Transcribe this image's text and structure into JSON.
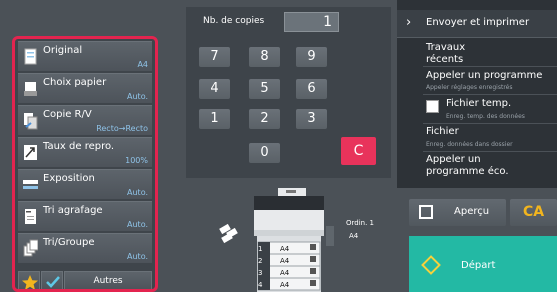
{
  "left_panel": {
    "items": [
      {
        "label": "Original",
        "value": "A4",
        "icon": "original-icon"
      },
      {
        "label": "Choix papier",
        "value": "Auto.",
        "icon": "paper-icon"
      },
      {
        "label": "Copie R/V",
        "value": "Recto→Recto",
        "icon": "duplex-icon"
      },
      {
        "label": "Taux de repro.",
        "value": "100%",
        "icon": "ratio-icon"
      },
      {
        "label": "Exposition",
        "value": "Auto.",
        "icon": "exposure-icon"
      },
      {
        "label": "Tri agrafage",
        "value": "Auto.",
        "icon": "staple-icon"
      },
      {
        "label": "Tri/Groupe",
        "value": "Auto.",
        "icon": "sort-icon"
      }
    ],
    "autres": "Autres"
  },
  "keypad": {
    "label": "Nb. de copies",
    "value": "1",
    "keys": [
      "7",
      "8",
      "9",
      "4",
      "5",
      "6",
      "1",
      "2",
      "3",
      "0"
    ],
    "clear": "C"
  },
  "right_panel": {
    "send_print": "Envoyer et imprimer",
    "items": [
      {
        "label": "Travaux\nrécents",
        "sub": ""
      },
      {
        "label": "Appeler un programme",
        "sub": "Appeler réglages enregistrés"
      },
      {
        "label": "Fichier temp.",
        "sub": "Enreg. temp. des données"
      },
      {
        "label": "Fichier",
        "sub": "Enreg. données dans dossier"
      },
      {
        "label": "Appeler un\nprogramme éco.",
        "sub": ""
      }
    ]
  },
  "machine": {
    "trays": [
      {
        "num": "1",
        "size": "A4"
      },
      {
        "num": "2",
        "size": "A4"
      },
      {
        "num": "3",
        "size": "A4"
      },
      {
        "num": "4",
        "size": "A4"
      }
    ],
    "output_label": "Ordin. 1",
    "output_size": "A4"
  },
  "actions": {
    "preview": "Aperçu",
    "ca": "CA",
    "start": "Départ"
  },
  "colors": {
    "highlight": "#e3244f",
    "value_text": "#8fc3e8",
    "start": "#23b9a4",
    "ca": "#f2b51e",
    "clear": "#e8335b"
  }
}
